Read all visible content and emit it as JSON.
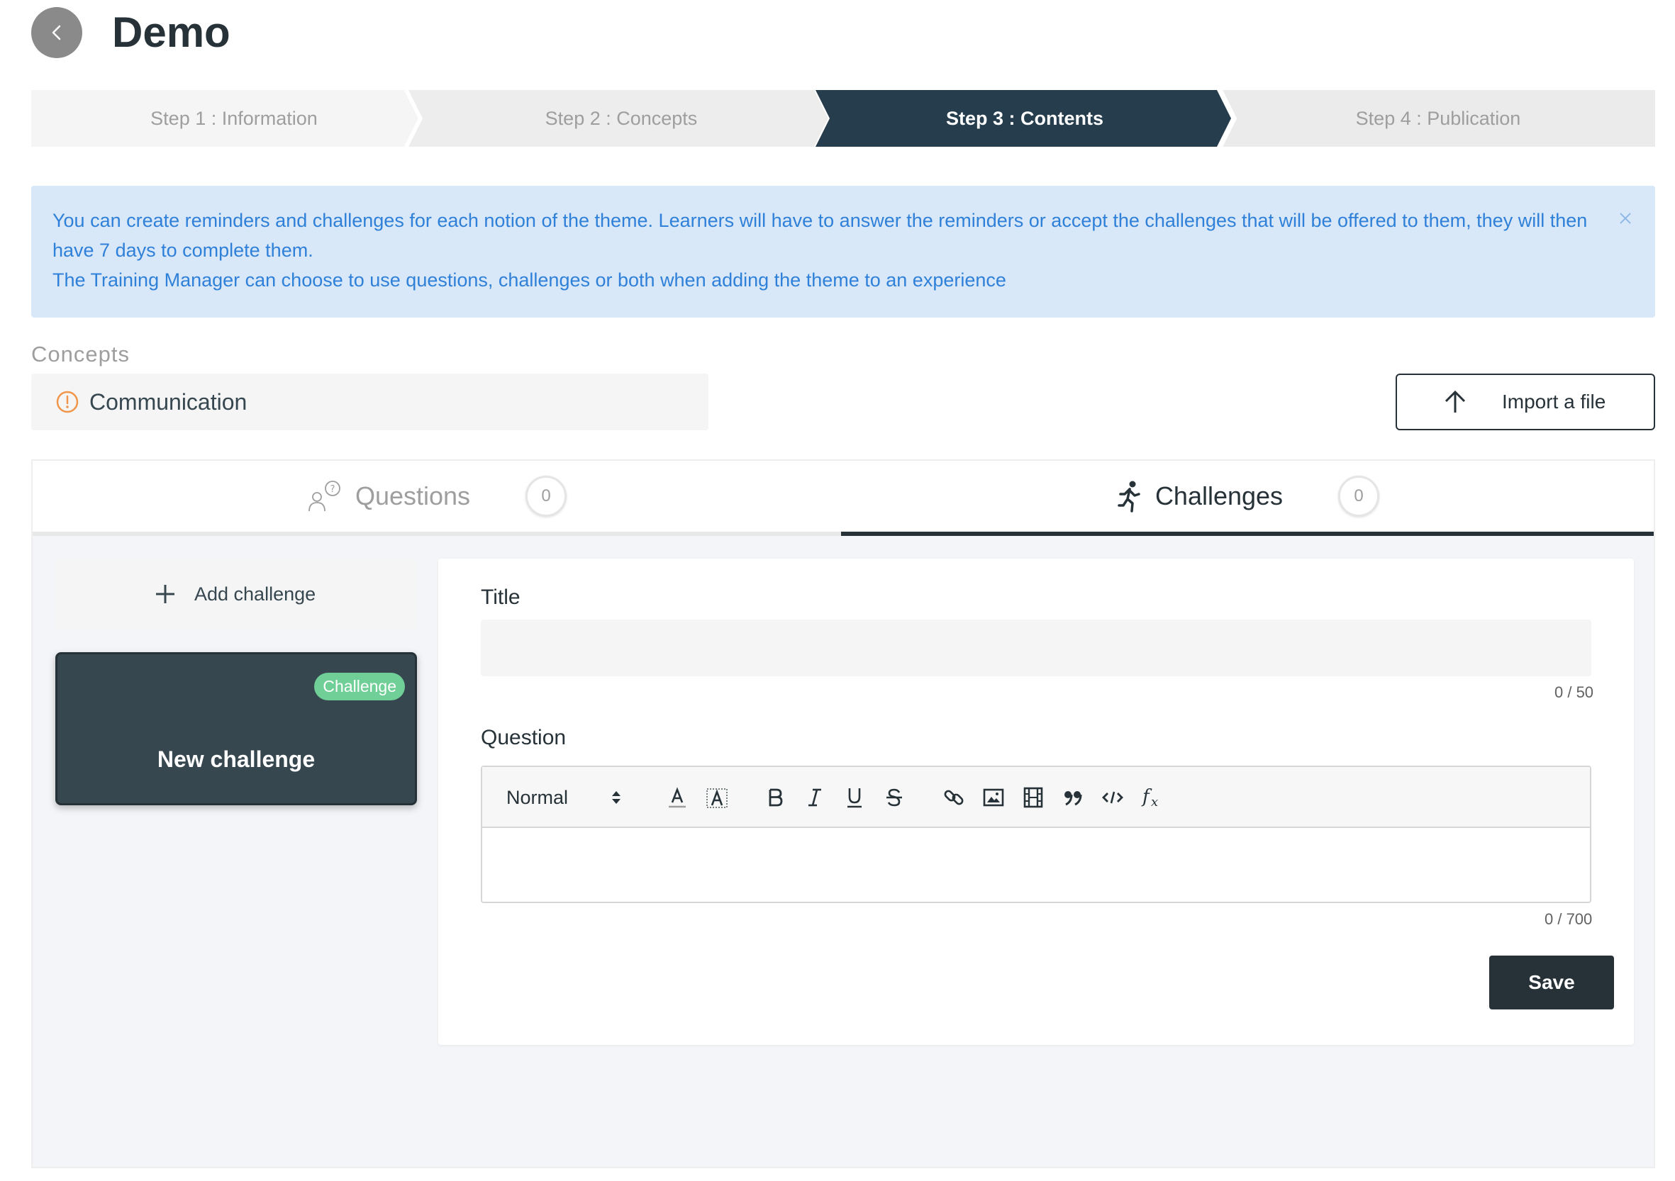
{
  "header": {
    "title": "Demo"
  },
  "stepper": {
    "steps": [
      {
        "label": "Step 1 : Information",
        "active": false
      },
      {
        "label": "Step 2 : Concepts",
        "active": false
      },
      {
        "label": "Step 3 : Contents",
        "active": true
      },
      {
        "label": "Step 4 : Publication",
        "active": false
      }
    ]
  },
  "alert": {
    "line1": "You can create reminders and challenges for each notion of the theme. Learners will have to answer the reminders or accept the challenges that will be offered to them, they will then have 7 days to complete them.",
    "line2": "The Training Manager can choose to use questions, challenges or both when adding the theme to an experience"
  },
  "concepts": {
    "label": "Concepts",
    "selected": "Communication"
  },
  "import_button": {
    "label": "Import a file"
  },
  "tabs": [
    {
      "label": "Questions",
      "count": "0",
      "active": false,
      "icon": "question-people-icon"
    },
    {
      "label": "Challenges",
      "count": "0",
      "active": true,
      "icon": "running-person-icon"
    }
  ],
  "sidebar": {
    "add_label": "Add challenge",
    "cards": [
      {
        "badge": "Challenge",
        "title": "New challenge"
      }
    ]
  },
  "form": {
    "title_label": "Title",
    "title_value": "",
    "title_counter": "0 / 50",
    "question_label": "Question",
    "format_value": "Normal",
    "question_counter": "0 / 700",
    "save_label": "Save"
  },
  "colors": {
    "primary": "#263238",
    "card": "#37474f",
    "alert_bg": "#d9e8f9",
    "alert_text": "#2f80d8",
    "badge": "#6fcf97",
    "warning": "#f0954a"
  }
}
